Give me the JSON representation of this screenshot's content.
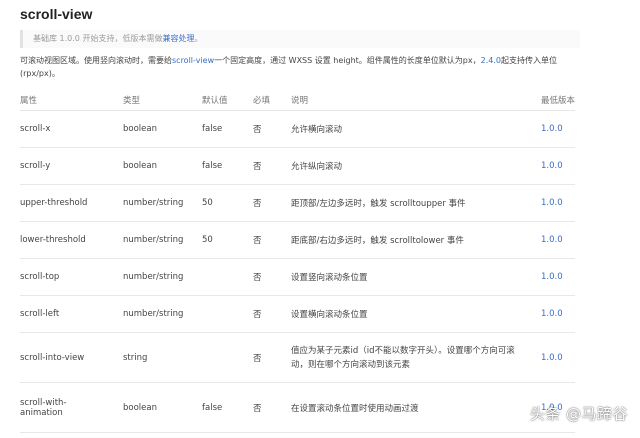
{
  "title": "scroll-view",
  "note": {
    "text": "基础库 1.0.0 开始支持，低版本需做",
    "link": "兼容处理",
    "suffix": "。"
  },
  "description": {
    "part1": "可滚动视图区域。使用竖向滚动时，需要给",
    "link1": "scroll-view",
    "part2": "一个固定高度，通过 WXSS 设置 height。组件属性的长度单位默认为px，",
    "link2": "2.4.0",
    "part3": "起支持传入单位(rpx/px)。"
  },
  "table": {
    "headers": {
      "attr": "属性",
      "type": "类型",
      "default": "默认值",
      "required": "必填",
      "desc": "说明",
      "version": "最低版本"
    },
    "rows": [
      {
        "attr": "scroll-x",
        "type": "boolean",
        "default": "false",
        "required": "否",
        "desc": "允许横向滚动",
        "version": "1.0.0"
      },
      {
        "attr": "scroll-y",
        "type": "boolean",
        "default": "false",
        "required": "否",
        "desc": "允许纵向滚动",
        "version": "1.0.0"
      },
      {
        "attr": "upper-threshold",
        "type": "number/string",
        "default": "50",
        "required": "否",
        "desc": "距顶部/左边多远时，触发 scrolltoupper 事件",
        "version": "1.0.0"
      },
      {
        "attr": "lower-threshold",
        "type": "number/string",
        "default": "50",
        "required": "否",
        "desc": "距底部/右边多远时，触发 scrolltolower 事件",
        "version": "1.0.0"
      },
      {
        "attr": "scroll-top",
        "type": "number/string",
        "default": "",
        "required": "否",
        "desc": "设置竖向滚动条位置",
        "version": "1.0.0"
      },
      {
        "attr": "scroll-left",
        "type": "number/string",
        "default": "",
        "required": "否",
        "desc": "设置横向滚动条位置",
        "version": "1.0.0"
      },
      {
        "attr": "scroll-into-view",
        "type": "string",
        "default": "",
        "required": "否",
        "desc": "值应为某子元素id（id不能以数字开头）。设置哪个方向可滚动，则在哪个方向滚动到该元素",
        "version": "1.0.0"
      },
      {
        "attr": "scroll-with-animation",
        "type": "boolean",
        "default": "false",
        "required": "否",
        "desc": "在设置滚动条位置时使用动画过渡",
        "version": "1.0.0"
      }
    ]
  },
  "watermark": "头条 @马蹄谷"
}
